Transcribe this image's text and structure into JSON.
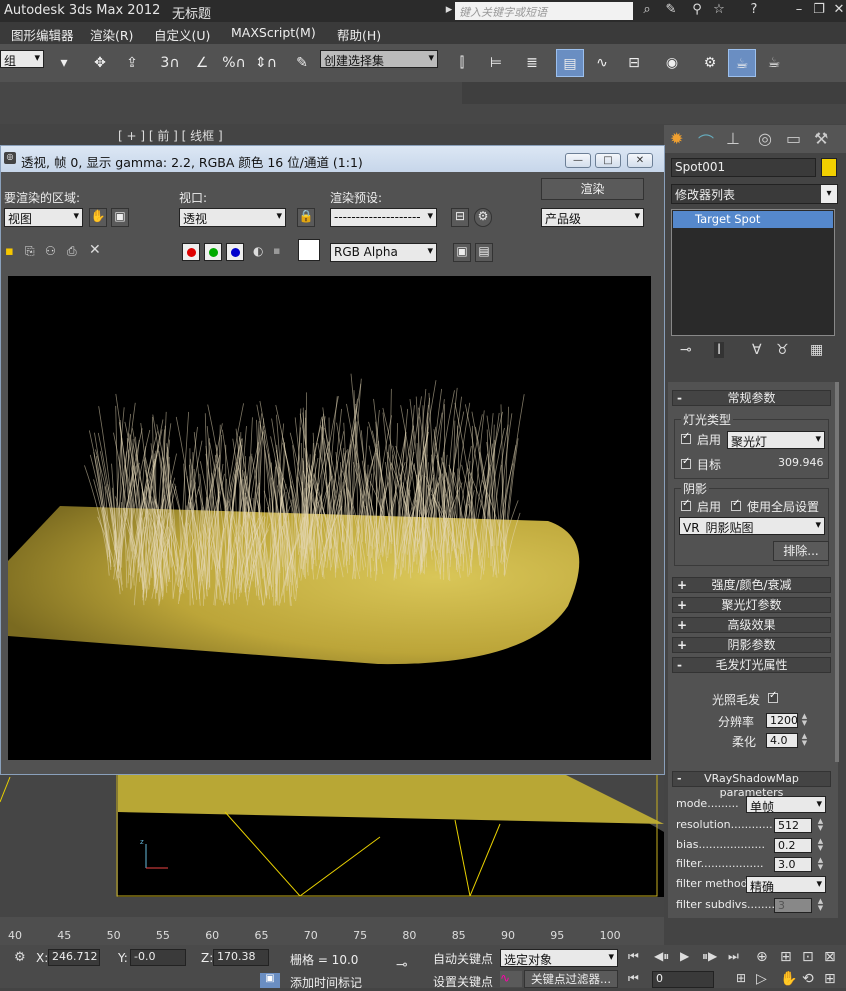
{
  "title": {
    "app": "Autodesk 3ds Max  2012",
    "doc": "无标题",
    "search_placeholder": "键入关键字或短语"
  },
  "menu": [
    "图形编辑器",
    "渲染(R)",
    "自定义(U)",
    "MAXScript(M)",
    "帮助(H)"
  ],
  "toolbar": {
    "selection_set": "创建选择集",
    "left_combo": "组"
  },
  "viewport_label": "[ + ] [ 前 ] [ 线框 ]",
  "render_window": {
    "title": "透视, 帧 0, 显示 gamma: 2.2, RGBA 颜色 16 位/通道 (1:1)",
    "area_label": "要渲染的区域:",
    "area_value": "视图",
    "viewport_label": "视口:",
    "viewport_value": "透视",
    "preset_label": "渲染预设:",
    "preset_value": "--------------------",
    "render_button": "渲染",
    "quality_value": "产品级",
    "channel_value": "RGB Alpha"
  },
  "panel": {
    "object_name": "Spot001",
    "modifier_list": "修改器列表",
    "stack_item": "Target Spot",
    "general": {
      "title": "常规参数",
      "light_type_group": "灯光类型",
      "enable": "启用",
      "type": "聚光灯",
      "target": "目标",
      "target_dist": "309.946",
      "shadow_group": "阴影",
      "shadow_enable": "启用",
      "use_global": "使用全局设置",
      "shadow_type": "VR_阴影贴图",
      "exclude": "排除..."
    },
    "collapsed": [
      "强度/颜色/衰减",
      "聚光灯参数",
      "高级效果",
      "阴影参数"
    ],
    "hair": {
      "title": "毛发灯光属性",
      "light_hair": "光照毛发",
      "resolution_label": "分辨率",
      "resolution": "1200",
      "softness_label": "柔化",
      "softness": "4.0"
    },
    "vray": {
      "title": "VRayShadowMap parameters",
      "mode_label": "mode.........",
      "mode": "单帧",
      "res_label": "resolution............",
      "res": "512",
      "bias_label": "bias...................",
      "bias": "0.2",
      "filter_label": "filter..................",
      "filter": "3.0",
      "fmethod_label": "filter method.",
      "fmethod": "精确",
      "fsub_label": "filter subdivs.........",
      "fsub": "3"
    }
  },
  "timeline_ticks": [
    "40",
    "45",
    "50",
    "55",
    "60",
    "65",
    "70",
    "75",
    "80",
    "85",
    "90",
    "95",
    "100"
  ],
  "status": {
    "x_label": "X:",
    "x": "246.712",
    "y_label": "Y:",
    "y": "-0.0",
    "z_label": "Z:",
    "z": "170.38",
    "grid": "栅格 = 10.0",
    "autokey": "自动关键点",
    "selected": "选定对象",
    "setkey": "设置关键点",
    "keyfilter": "关键点过滤器...",
    "frame": "0",
    "add_time_tag": "添加时间标记"
  }
}
